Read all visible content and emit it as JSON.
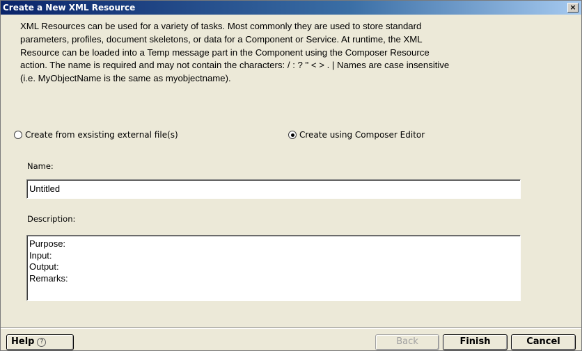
{
  "window": {
    "title": "Create a New XML Resource",
    "close_glyph": "×"
  },
  "intro": {
    "lines": [
      "XML Resources can be used for a variety of tasks. Most commonly they are used to store standard",
      "parameters, profiles, document skeletons, or data for a Component or Service.  At runtime, the XML",
      "Resource can be loaded into a Temp message part in the Component using the Composer Resource",
      "action.  The name is required and may not contain the characters:  / : ?  \" < > . |  Names are case insensitive",
      "(i.e. MyObjectName is the same as myobjectname)."
    ]
  },
  "options": {
    "external_file": {
      "label": "Create from exsisting external file(s)",
      "checked": false
    },
    "composer_editor": {
      "label": "Create using Composer Editor",
      "checked": true
    }
  },
  "name_field": {
    "label": "Name:",
    "value": "Untitled"
  },
  "description_field": {
    "label": "Description:",
    "lines": [
      "Purpose:",
      "Input:",
      "Output:",
      "Remarks:"
    ]
  },
  "buttons": {
    "help": "Help",
    "help_glyph": "?",
    "back": "Back",
    "finish": "Finish",
    "cancel": "Cancel"
  }
}
